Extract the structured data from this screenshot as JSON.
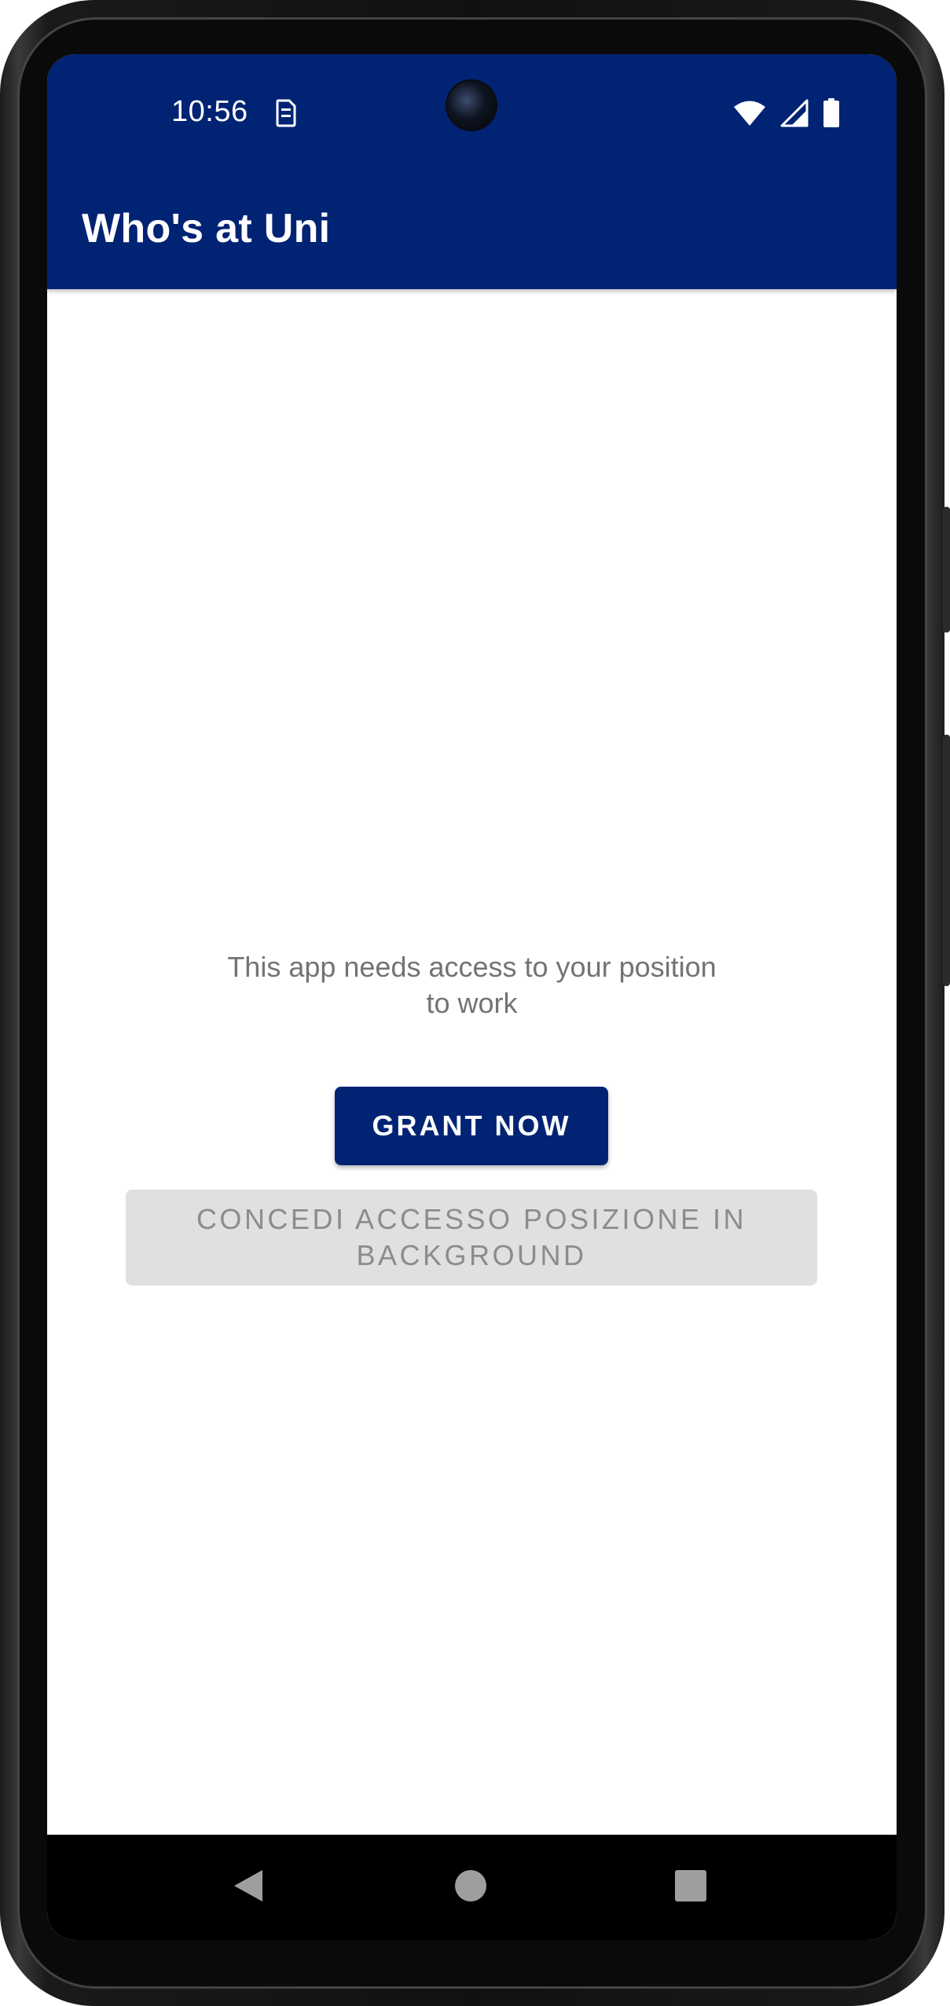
{
  "status_bar": {
    "time": "10:56",
    "notification_icon": "sim-card-alert-icon",
    "icons": [
      "wifi-icon",
      "cellular-signal-icon",
      "battery-icon"
    ]
  },
  "app_bar": {
    "title": "Who's at Uni",
    "color": "#012374"
  },
  "main": {
    "message_lines": [
      "This app needs access to your position",
      "to work"
    ],
    "grant_button_label": "GRANT NOW",
    "background_button_lines": [
      "CONCEDI ACCESSO POSIZIONE IN",
      "BACKGROUND"
    ]
  },
  "nav_bar": {
    "buttons": [
      "back-icon",
      "home-icon",
      "recents-icon"
    ]
  },
  "colors": {
    "primary": "#012374",
    "message_text": "#737373",
    "disabled_button_bg": "#e0e0e0",
    "disabled_button_text": "#8c8c8c"
  }
}
